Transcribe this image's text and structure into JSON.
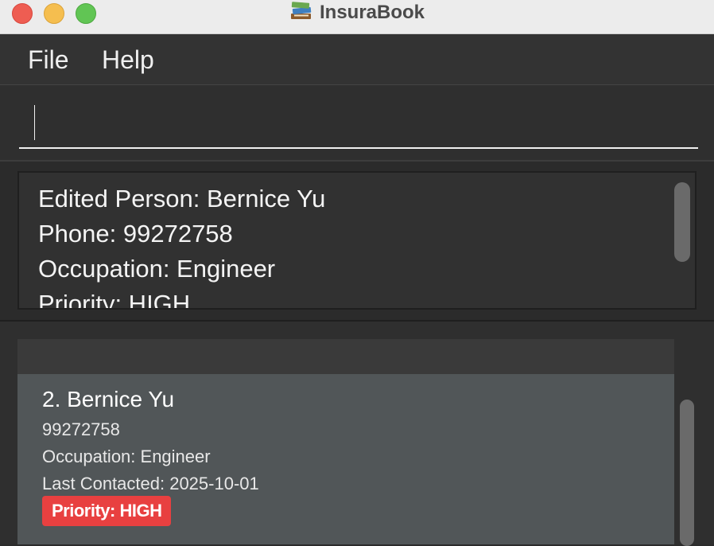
{
  "window": {
    "title": "InsuraBook"
  },
  "menu": {
    "file": "File",
    "help": "Help"
  },
  "command": {
    "value": "",
    "placeholder": ""
  },
  "result": {
    "lines": [
      "Edited Person: Bernice Yu",
      "Phone: 99272758",
      "Occupation: Engineer",
      "Priority: HIGH"
    ]
  },
  "person_list": {
    "cards": [
      {
        "name": "2. Bernice Yu",
        "phone": "99272758",
        "occupation": "Occupation: Engineer",
        "last_contacted": "Last Contacted: 2025-10-01",
        "priority_badge": "Priority: HIGH"
      }
    ]
  },
  "colors": {
    "priority_high": "#e84040",
    "card_bg": "#515658",
    "app_bg": "#2b2b2b"
  },
  "icons": [
    "app-books-icon"
  ]
}
